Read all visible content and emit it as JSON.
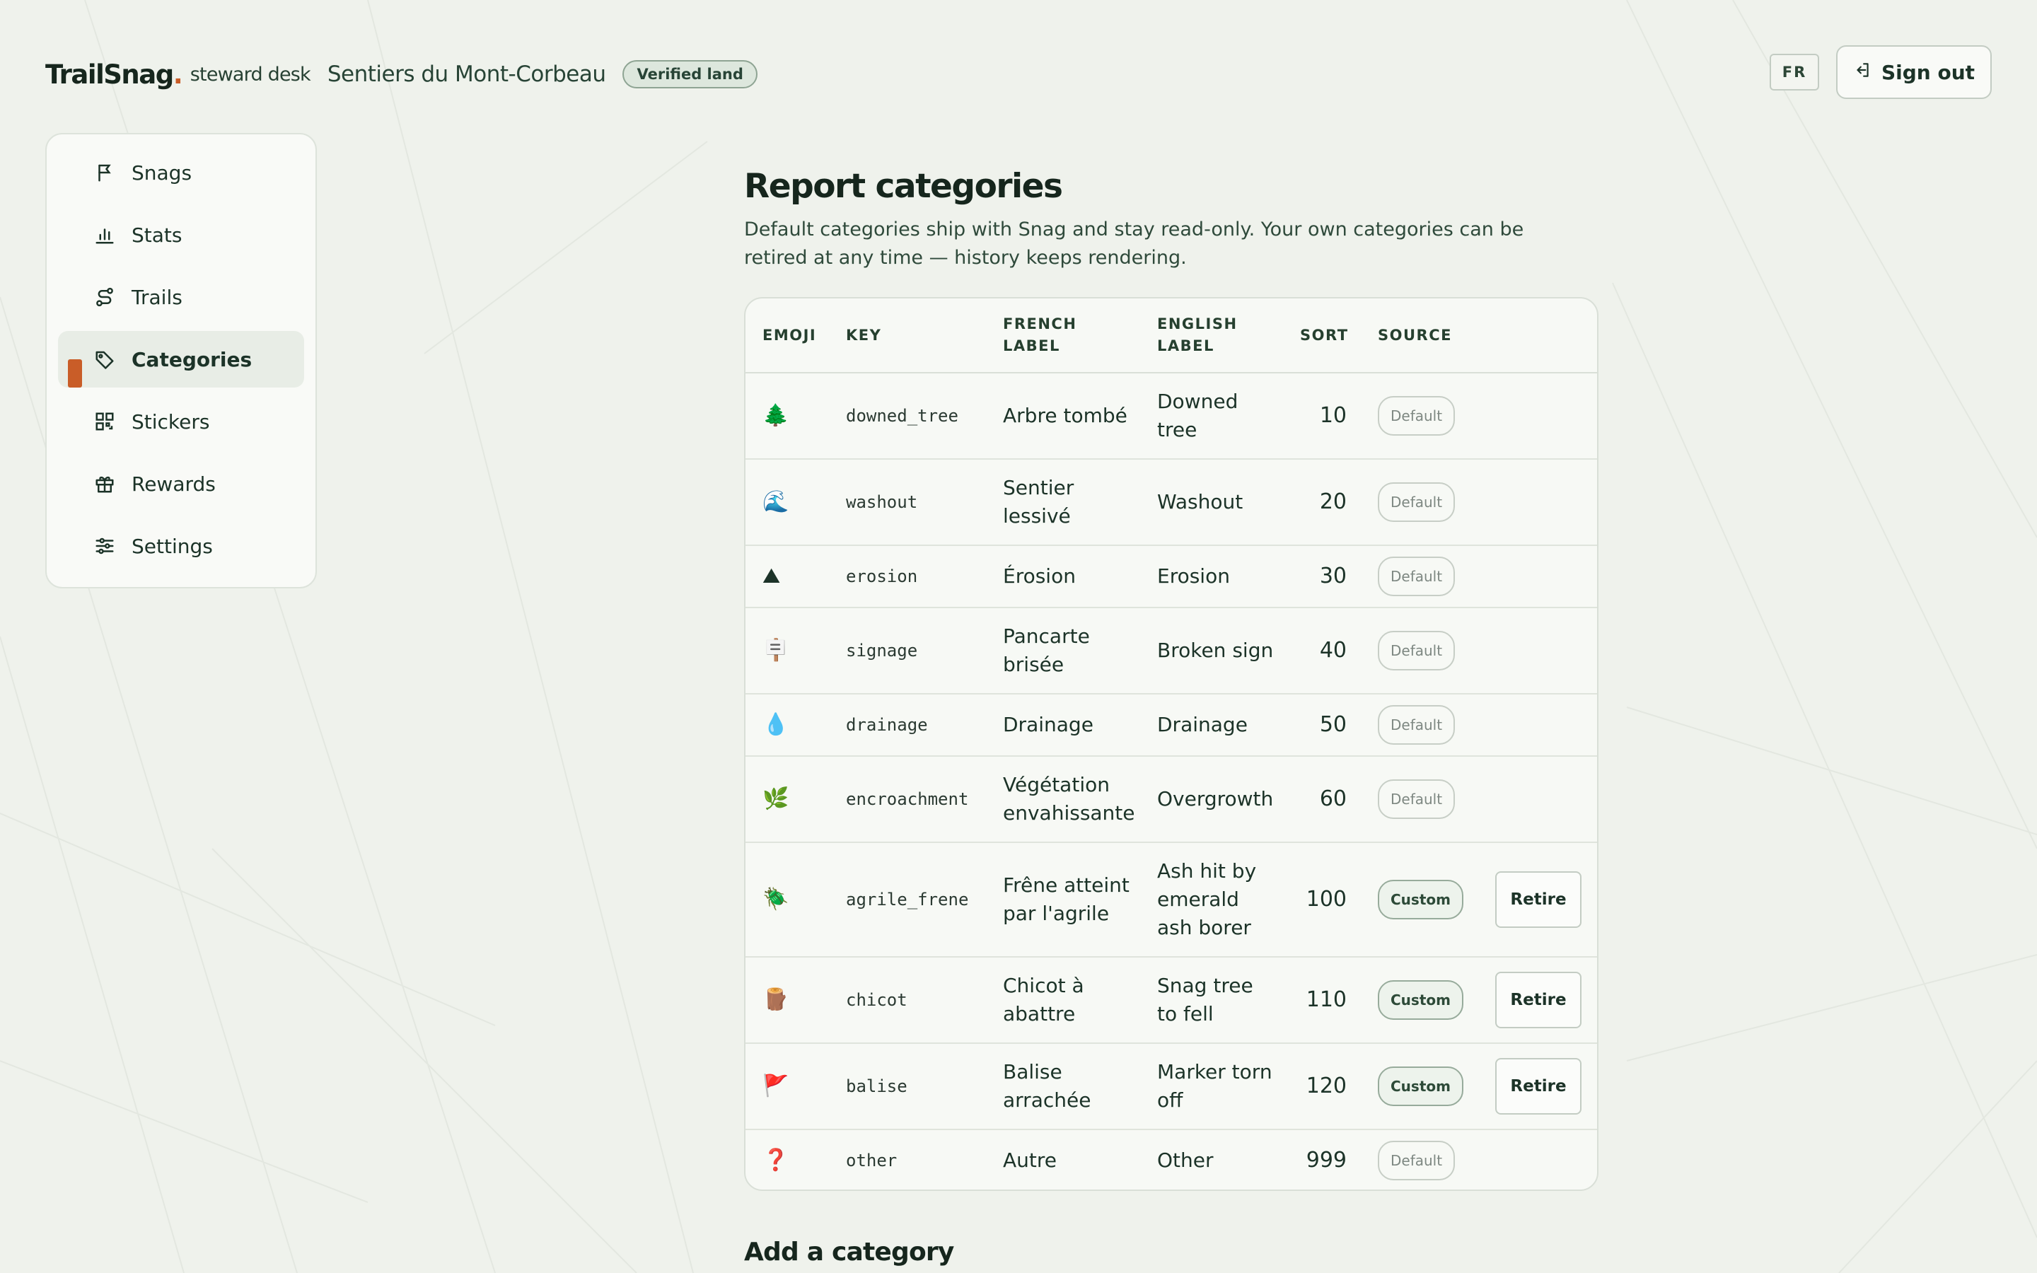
{
  "header": {
    "logo": "TrailSnag",
    "logo_dot": ".",
    "logo_sub": "steward desk",
    "site_name": "Sentiers du Mont-Corbeau",
    "verified_badge": "Verified land",
    "lang_button": "FR",
    "signout_label": "Sign out"
  },
  "sidebar": {
    "items": [
      {
        "label": "Snags",
        "icon": "flag-icon"
      },
      {
        "label": "Stats",
        "icon": "bar-chart-icon"
      },
      {
        "label": "Trails",
        "icon": "route-icon"
      },
      {
        "label": "Categories",
        "icon": "tag-icon",
        "active": true
      },
      {
        "label": "Stickers",
        "icon": "qr-code-icon"
      },
      {
        "label": "Rewards",
        "icon": "gift-icon"
      },
      {
        "label": "Settings",
        "icon": "sliders-icon"
      }
    ]
  },
  "main": {
    "title": "Report categories",
    "description": "Default categories ship with Snag and stay read-only. Your own categories can be retired at any time — history keeps rendering.",
    "add_title": "Add a category"
  },
  "table": {
    "headers": {
      "emoji": "EMOJI",
      "key": "KEY",
      "fr_line1": "FRENCH",
      "fr_line2": "LABEL",
      "en_line1": "ENGLISH",
      "en_line2": "LABEL",
      "sort": "SORT",
      "source": "SOURCE"
    },
    "retire_label": "Retire",
    "rows": [
      {
        "emoji": "🌲",
        "key": "downed_tree",
        "fr": "Arbre tombé",
        "en": "Downed tree",
        "sort": "10",
        "source": "Default"
      },
      {
        "emoji": "🌊",
        "key": "washout",
        "fr": "Sentier lessivé",
        "en": "Washout",
        "sort": "20",
        "source": "Default"
      },
      {
        "emoji": "⛰",
        "key": "erosion",
        "fr": "Érosion",
        "en": "Erosion",
        "sort": "30",
        "source": "Default"
      },
      {
        "emoji": "🪧",
        "key": "signage",
        "fr": "Pancarte brisée",
        "en": "Broken sign",
        "sort": "40",
        "source": "Default"
      },
      {
        "emoji": "💧",
        "key": "drainage",
        "fr": "Drainage",
        "en": "Drainage",
        "sort": "50",
        "source": "Default"
      },
      {
        "emoji": "🌿",
        "key": "encroachment",
        "fr": "Végétation envahissante",
        "en": "Overgrowth",
        "sort": "60",
        "source": "Default"
      },
      {
        "emoji": "🪲",
        "key": "agrile_frene",
        "fr": "Frêne atteint par l'agrile",
        "en": "Ash hit by emerald ash borer",
        "sort": "100",
        "source": "Custom"
      },
      {
        "emoji": "🪵",
        "key": "chicot",
        "fr": "Chicot à abattre",
        "en": "Snag tree to fell",
        "sort": "110",
        "source": "Custom"
      },
      {
        "emoji": "🚩",
        "key": "balise",
        "fr": "Balise arrachée",
        "en": "Marker torn off",
        "sort": "120",
        "source": "Custom"
      },
      {
        "emoji": "❓",
        "key": "other",
        "fr": "Autre",
        "en": "Other",
        "sort": "999",
        "source": "Default"
      }
    ]
  },
  "colors": {
    "accent": "#c95d28",
    "background": "#eff2ec",
    "text": "#1c3328"
  }
}
